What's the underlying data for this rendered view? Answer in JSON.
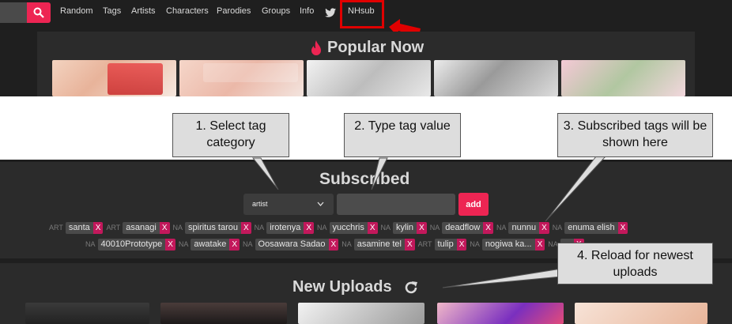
{
  "nav": {
    "links": [
      "Random",
      "Tags",
      "Artists",
      "Characters",
      "Parodies",
      "Groups",
      "Info"
    ],
    "twitter_icon": "twitter-icon",
    "nhsub_label": "NHsub"
  },
  "popular": {
    "title": "Popular Now",
    "icon": "fire-icon"
  },
  "callouts": {
    "c1": "1. Select tag category",
    "c2": "2. Type tag value",
    "c3": "3. Subscribed tags will be shown here",
    "c4": "4. Reload for newest uploads"
  },
  "subscribed": {
    "title": "Subscribed",
    "select_value": "artist",
    "add_label": "add",
    "tags": [
      {
        "cat": "ART",
        "val": "santa"
      },
      {
        "cat": "ART",
        "val": "asanagi"
      },
      {
        "cat": "NA",
        "val": "spiritus tarou"
      },
      {
        "cat": "NA",
        "val": "irotenya"
      },
      {
        "cat": "NA",
        "val": "yucchris"
      },
      {
        "cat": "NA",
        "val": "kylin"
      },
      {
        "cat": "NA",
        "val": "deadflow"
      },
      {
        "cat": "NA",
        "val": "nunnu"
      },
      {
        "cat": "NA",
        "val": "enuma elish"
      },
      {
        "cat": "NA",
        "val": "40010Prototype"
      },
      {
        "cat": "NA",
        "val": "awatake"
      },
      {
        "cat": "NA",
        "val": "Oosawara Sadao"
      },
      {
        "cat": "NA",
        "val": "asamine tel"
      },
      {
        "cat": "ART",
        "val": "tulip"
      },
      {
        "cat": "NA",
        "val": "nogiwa ka..."
      },
      {
        "cat": "NA",
        "val": "..."
      }
    ],
    "remove_label": "X"
  },
  "new_uploads": {
    "title": "New Uploads",
    "icon": "refresh-icon"
  },
  "colors": {
    "accent": "#ed2553",
    "annotation": "#e00000"
  }
}
